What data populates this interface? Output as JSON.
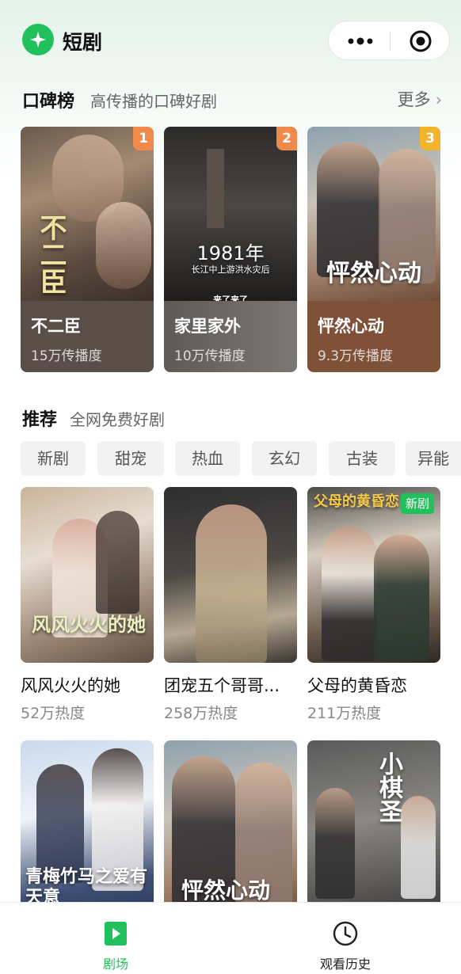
{
  "header": {
    "title": "短剧",
    "logo_icon": "sparkle-icon",
    "more_icon": "more-dots-icon",
    "close_icon": "target-icon"
  },
  "ranking": {
    "title": "口碑榜",
    "subtitle": "高传播的口碑好剧",
    "more_label": "更多",
    "items": [
      {
        "rank": "1",
        "name": "不二臣",
        "plays": "15万传播度",
        "badge_color": "#f08a4b",
        "poster_text": "不二臣"
      },
      {
        "rank": "2",
        "name": "家里家外",
        "plays": "10万传播度",
        "badge_color": "#f08a4b",
        "poster_text": "1981年",
        "poster_sub": "长江中上游洪水灾后",
        "poster_tag": "来了来了"
      },
      {
        "rank": "3",
        "name": "怦然心动",
        "plays": "9.3万传播度",
        "badge_color": "#f1b42a",
        "poster_text": "怦然心动"
      }
    ]
  },
  "recommend": {
    "title": "推荐",
    "subtitle": "全网免费好剧",
    "chips": [
      "新剧",
      "甜宠",
      "热血",
      "玄幻",
      "古装",
      "异能"
    ],
    "items": [
      {
        "title": "风风火火的她",
        "heat": "52万热度",
        "poster_text": "风风火火的她"
      },
      {
        "title": "团宠五个哥哥...",
        "heat": "258万热度",
        "poster_text": ""
      },
      {
        "title": "父母的黄昏恋",
        "heat": "211万热度",
        "poster_text": "父母的黄昏恋",
        "badge": "新剧"
      },
      {
        "title": "",
        "heat": "",
        "poster_text": "青梅竹马之爱有天意"
      },
      {
        "title": "",
        "heat": "",
        "poster_text": "怦然心动"
      },
      {
        "title": "",
        "heat": "",
        "poster_text": "小棋圣"
      }
    ]
  },
  "tabbar": {
    "tabs": [
      {
        "label": "剧场",
        "icon": "play-icon",
        "active": true
      },
      {
        "label": "观看历史",
        "icon": "clock-icon",
        "active": false
      }
    ],
    "active_color": "#20c05c"
  }
}
